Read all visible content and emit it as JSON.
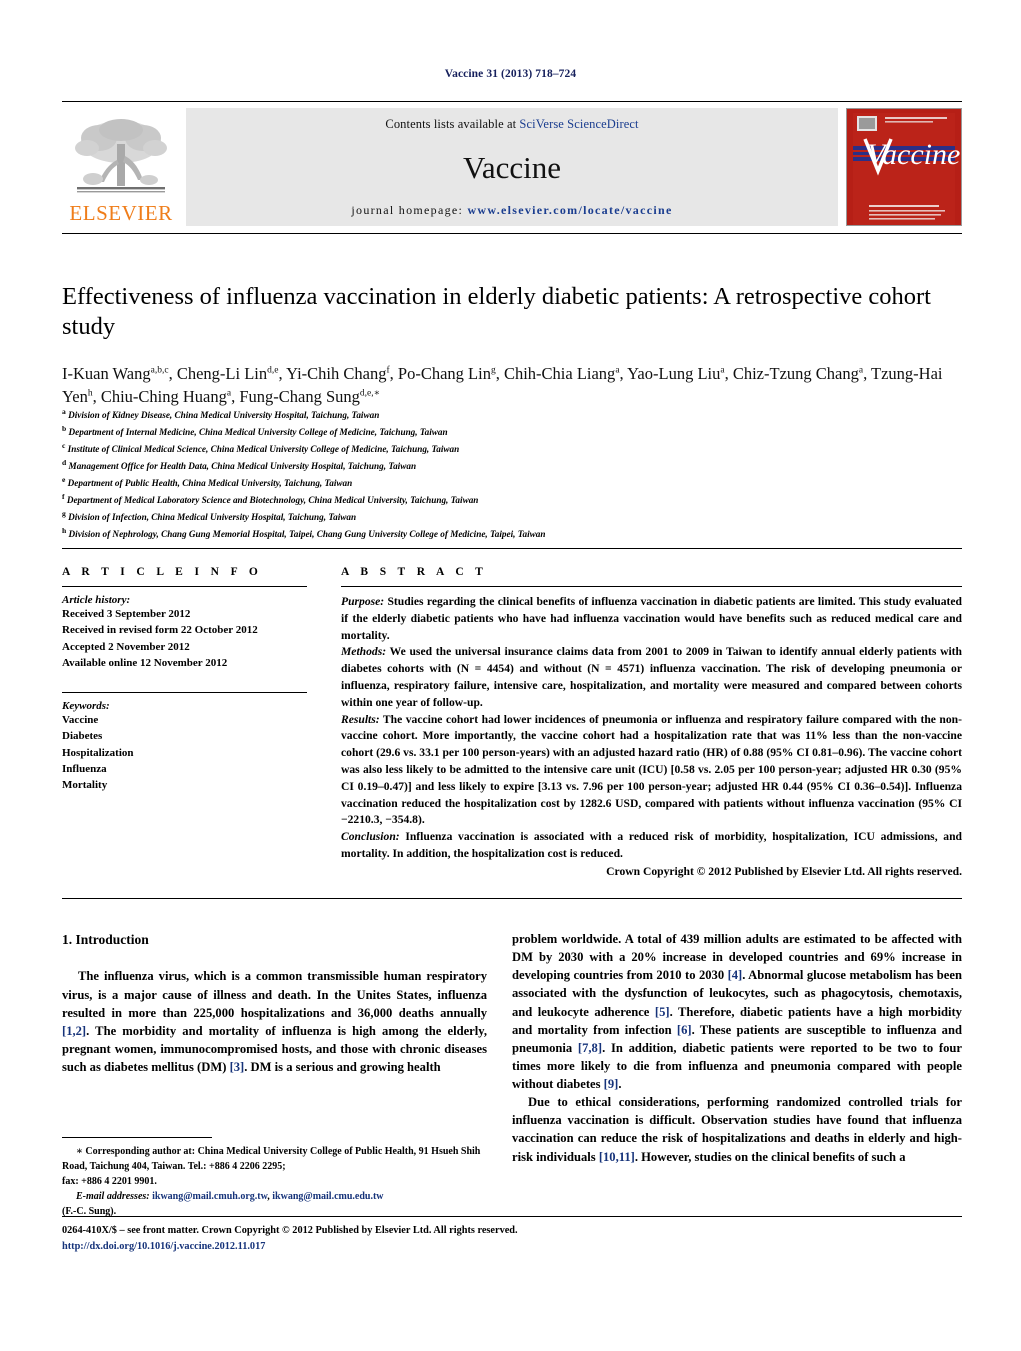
{
  "running_head": "Vaccine 31 (2013) 718–724",
  "banner": {
    "publisher_name": "ELSEVIER",
    "contents_prefix": "Contents lists available at ",
    "contents_link": "SciVerse ScienceDirect",
    "journal_name": "Vaccine",
    "homepage_prefix": "journal homepage: ",
    "homepage_url": "www.elsevier.com/locate/vaccine",
    "cover_title": "Vaccine",
    "cover_color": "#b61f16",
    "link_color": "#1a3d8f",
    "elsevier_orange": "#ef7d1a"
  },
  "article": {
    "title": "Effectiveness of influenza vaccination in elderly diabetic patients: A retrospective cohort study",
    "authors": [
      {
        "name": "I-Kuan Wang",
        "sup": "a,b,c"
      },
      {
        "name": "Cheng-Li Lin",
        "sup": "d,e"
      },
      {
        "name": "Yi-Chih Chang",
        "sup": "f"
      },
      {
        "name": "Po-Chang Lin",
        "sup": "g"
      },
      {
        "name": "Chih-Chia Liang",
        "sup": "a"
      },
      {
        "name": "Yao-Lung Liu",
        "sup": "a"
      },
      {
        "name": "Chiz-Tzung Chang",
        "sup": "a"
      },
      {
        "name": "Tzung-Hai Yen",
        "sup": "h"
      },
      {
        "name": "Chiu-Ching Huang",
        "sup": "a"
      },
      {
        "name": "Fung-Chang Sung",
        "sup": "d,e,∗"
      }
    ],
    "affiliations": [
      {
        "marker": "a",
        "text": "Division of Kidney Disease, China Medical University Hospital, Taichung, Taiwan"
      },
      {
        "marker": "b",
        "text": "Department of Internal Medicine, China Medical University College of Medicine, Taichung, Taiwan"
      },
      {
        "marker": "c",
        "text": "Institute of Clinical Medical Science, China Medical University College of Medicine, Taichung, Taiwan"
      },
      {
        "marker": "d",
        "text": "Management Office for Health Data, China Medical University Hospital, Taichung, Taiwan"
      },
      {
        "marker": "e",
        "text": "Department of Public Health, China Medical University, Taichung, Taiwan"
      },
      {
        "marker": "f",
        "text": "Department of Medical Laboratory Science and Biotechnology, China Medical University, Taichung, Taiwan"
      },
      {
        "marker": "g",
        "text": "Division of Infection, China Medical University Hospital, Taichung, Taiwan"
      },
      {
        "marker": "h",
        "text": "Division of Nephrology, Chang Gung Memorial Hospital, Taipei, Chang Gung University College of Medicine, Taipei, Taiwan"
      }
    ]
  },
  "article_info": {
    "heading": "A R T I C L E    I N F O",
    "history_label": "Article history:",
    "history": [
      "Received 3 September 2012",
      "Received in revised form 22 October 2012",
      "Accepted 2 November 2012",
      "Available online 12 November 2012"
    ],
    "keywords_label": "Keywords:",
    "keywords": [
      "Vaccine",
      "Diabetes",
      "Hospitalization",
      "Influenza",
      "Mortality"
    ]
  },
  "abstract": {
    "heading": "A B S T R A C T",
    "sections": [
      {
        "label": "Purpose:",
        "text": " Studies regarding the clinical benefits of influenza vaccination in diabetic patients are limited. This study evaluated if the elderly diabetic patients who have had influenza vaccination would have benefits such as reduced medical care and mortality."
      },
      {
        "label": "Methods:",
        "text": " We used the universal insurance claims data from 2001 to 2009 in Taiwan to identify annual elderly patients with diabetes cohorts with (N = 4454) and without (N = 4571) influenza vaccination. The risk of developing pneumonia or influenza, respiratory failure, intensive care, hospitalization, and mortality were measured and compared between cohorts within one year of follow-up."
      },
      {
        "label": "Results:",
        "text": " The vaccine cohort had lower incidences of pneumonia or influenza and respiratory failure compared with the non-vaccine cohort. More importantly, the vaccine cohort had a hospitalization rate that was 11% less than the non-vaccine cohort (29.6 vs. 33.1 per 100 person-years) with an adjusted hazard ratio (HR) of 0.88 (95% CI 0.81–0.96). The vaccine cohort was also less likely to be admitted to the intensive care unit (ICU) [0.58 vs. 2.05 per 100 person-year; adjusted HR 0.30 (95% CI 0.19–0.47)] and less likely to expire [3.13 vs. 7.96 per 100 person-year; adjusted HR 0.44 (95% CI 0.36–0.54)]. Influenza vaccination reduced the hospitalization cost by 1282.6 USD, compared with patients without influenza vaccination (95% CI −2210.3, −354.8)."
      },
      {
        "label": "Conclusion:",
        "text": " Influenza vaccination is associated with a reduced risk of morbidity, hospitalization, ICU admissions, and mortality. In addition, the hospitalization cost is reduced."
      }
    ],
    "copyright": "Crown Copyright © 2012 Published by Elsevier Ltd. All rights reserved."
  },
  "introduction": {
    "heading": "1.  Introduction",
    "left_paragraph_1_a": "The influenza virus, which is a common transmissible human respiratory virus, is a major cause of illness and death. In the Unites States, influenza resulted in more than 225,000 hospitalizations and 36,000 deaths annually ",
    "left_ref_1": "[1,2]",
    "left_paragraph_1_b": ". The morbidity and mortality of influenza is high among the elderly, pregnant women, immunocompromised hosts, and those with chronic diseases such as diabetes mellitus (DM) ",
    "left_ref_2": "[3]",
    "left_paragraph_1_c": ". DM is a serious and growing health",
    "right_paragraph_1_a": "problem worldwide. A total of 439 million adults are estimated to be affected with DM by 2030 with a 20% increase in developed countries and 69% increase in developing countries from 2010 to 2030 ",
    "right_ref_1": "[4]",
    "right_paragraph_1_b": ". Abnormal glucose metabolism has been associated with the dysfunction of leukocytes, such as phagocytosis, chemotaxis, and leukocyte adherence ",
    "right_ref_2": "[5]",
    "right_paragraph_1_c": ". Therefore, diabetic patients have a high morbidity and mortality from infection ",
    "right_ref_3": "[6]",
    "right_paragraph_1_d": ". These patients are susceptible to influenza and pneumonia ",
    "right_ref_4": "[7,8]",
    "right_paragraph_1_e": ". In addition, diabetic patients were reported to be two to four times more likely to die from influenza and pneumonia compared with people without diabetes ",
    "right_ref_5": "[9]",
    "right_paragraph_1_f": ".",
    "right_paragraph_2_a": "Due to ethical considerations, performing randomized controlled trials for influenza vaccination is difficult. Observation studies have found that influenza vaccination can reduce the risk of hospitalizations and deaths in elderly and high-risk individuals ",
    "right_ref_6": "[10,11]",
    "right_paragraph_2_b": ". However, studies on the clinical benefits of such a"
  },
  "footnotes": {
    "corresponding_marker": "∗",
    "corresponding_text": " Corresponding author at: China Medical University College of Public Health, 91 Hsueh Shih Road, Taichung 404, Taiwan. Tel.: +886 4 2206 2295;",
    "fax_line": "fax: +886 4 2201 9901.",
    "email_label": "E-mail addresses:",
    "email_1": "ikwang@mail.cmuh.org.tw",
    "email_2": "ikwang@mail.cmu.edu.tw",
    "email_attrib": "(F.-C. Sung)."
  },
  "frontmatter": {
    "line_1": "0264-410X/$ – see front matter. Crown Copyright © 2012 Published by Elsevier Ltd. All rights reserved.",
    "doi": "http://dx.doi.org/10.1016/j.vaccine.2012.11.017"
  }
}
